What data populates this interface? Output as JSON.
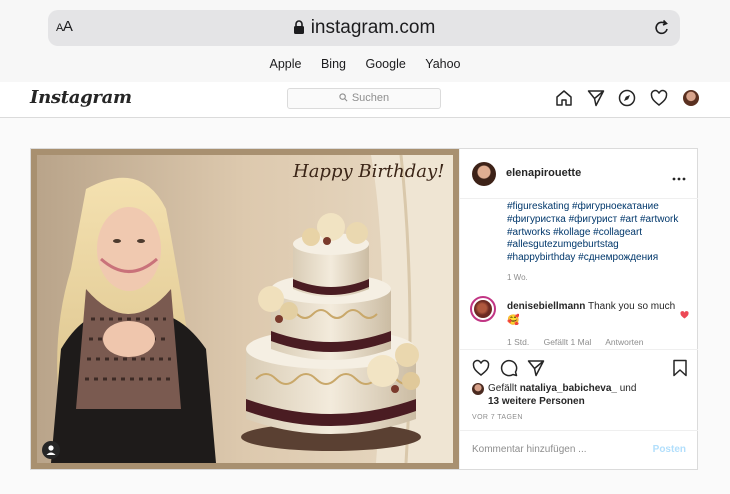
{
  "browser": {
    "aa_label_big": "A",
    "aa_label_small": "A",
    "url": "instagram.com",
    "favorites": [
      "Apple",
      "Bing",
      "Google",
      "Yahoo"
    ]
  },
  "nav": {
    "logo": "Instagram",
    "search_placeholder": "Suchen"
  },
  "post": {
    "image_overlay_text": "Happy Birthday!",
    "owner": "elenapirouette",
    "caption_lines": [
      "#figureskating #фигурноекатание",
      "#фигуристка #фигурист #art #artwork",
      "#artworks #kollage #collageart",
      "#allesgutezumgeburtstag",
      "#happybirthday #сднемрождения"
    ],
    "caption_age": "1 Wo.",
    "comment": {
      "author": "denisebiellmann",
      "text": "Thank you so much🥰",
      "age": "1 Std.",
      "likes": "Gefällt 1 Mal",
      "reply": "Antworten"
    },
    "likes": {
      "prefix": "Gefällt",
      "user": "nataliya_babicheva_",
      "connector": "und",
      "others": "13 weitere Personen"
    },
    "date": "VOR 7 TAGEN",
    "comment_placeholder": "Kommentar hinzufügen ...",
    "post_button": "Posten"
  },
  "colors": {
    "link_blue": "#00376b",
    "like_red": "#ed4956",
    "post_button_disabled": "#b2dffc"
  },
  "icons": [
    "lock-icon",
    "reload-icon",
    "search-icon",
    "home-icon",
    "direct-icon",
    "explore-icon",
    "heart-icon",
    "more-icon",
    "comment-icon",
    "share-icon",
    "bookmark-icon",
    "user-tag-icon"
  ]
}
